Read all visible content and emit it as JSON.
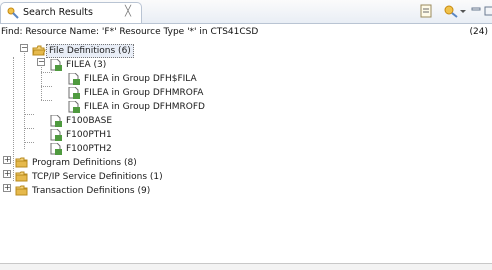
{
  "view": {
    "tab_title": "Search Results",
    "close_glyph": "╳",
    "status_text": "Find: Resource Name: 'F*' Resource Type '*' in CTS41CSD",
    "status_count": "(24)"
  },
  "tree": {
    "file_definitions": "File Definitions (6)",
    "filea": "FILEA (3)",
    "filea_children": [
      "FILEA in Group DFH$FILA",
      "FILEA in Group DFHMROFA",
      "FILEA in Group DFHMROFD"
    ],
    "files": [
      "F100BASE",
      "F100PTH1",
      "F100PTH2"
    ],
    "program_definitions": "Program Definitions (8)",
    "tcpip_definitions": "TCP/IP Service Definitions (1)",
    "transaction_definitions": "Transaction Definitions (9)"
  },
  "icons": {
    "folder_color": "#e6b94c",
    "file_color": "#4f9a3f"
  }
}
